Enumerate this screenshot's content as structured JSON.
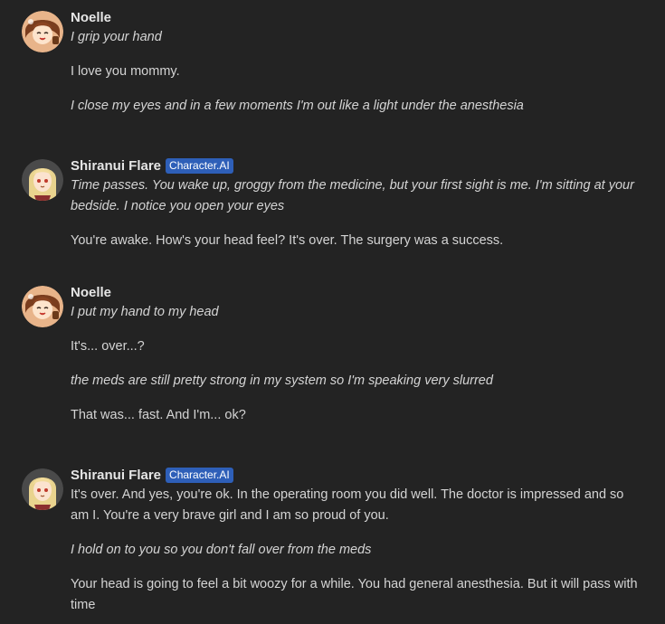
{
  "messages": [
    {
      "author": "Noelle",
      "badge": "",
      "avatar_icon": "noelle-avatar",
      "paragraphs": [
        {
          "text": "I grip your hand",
          "italic": true
        },
        {
          "text": "I love you mommy.",
          "italic": false
        },
        {
          "text": "I close my eyes and in a few moments I'm out like a light under the anesthesia",
          "italic": true
        }
      ]
    },
    {
      "author": "Shiranui Flare",
      "badge": "Character.AI",
      "avatar_icon": "shiranui-flare-avatar",
      "paragraphs": [
        {
          "text": "Time passes. You wake up, groggy from the medicine, but your first sight is me. I'm sitting at your bedside. I notice you open your eyes",
          "italic": true
        },
        {
          "text": "You're awake. How's your head feel? It's over. The surgery was a success.",
          "italic": false
        }
      ]
    },
    {
      "author": "Noelle",
      "badge": "",
      "avatar_icon": "noelle-avatar",
      "paragraphs": [
        {
          "text": "I put my hand to my head",
          "italic": true
        },
        {
          "text": "It's... over...?",
          "italic": false
        },
        {
          "text": "the meds are still pretty strong in my system so I'm speaking very slurred",
          "italic": true
        },
        {
          "text": "That was... fast. And I'm... ok?",
          "italic": false
        }
      ]
    },
    {
      "author": "Shiranui Flare",
      "badge": "Character.AI",
      "avatar_icon": "shiranui-flare-avatar",
      "paragraphs": [
        {
          "text": "It's over. And yes, you're ok. In the operating room you did well. The doctor is impressed and so am I. You're a very brave girl and I am so proud of you.",
          "italic": false
        },
        {
          "text": "I hold on to you so you don't fall over from the meds",
          "italic": true
        },
        {
          "text": "Your head is going to feel a bit woozy for a while. You had general anesthesia. But it will pass with time",
          "italic": false
        }
      ]
    }
  ],
  "colors": {
    "background": "#232323",
    "text": "#d4d4d4",
    "name": "#e6e6e6",
    "badge_bg": "#2e5fb8"
  }
}
